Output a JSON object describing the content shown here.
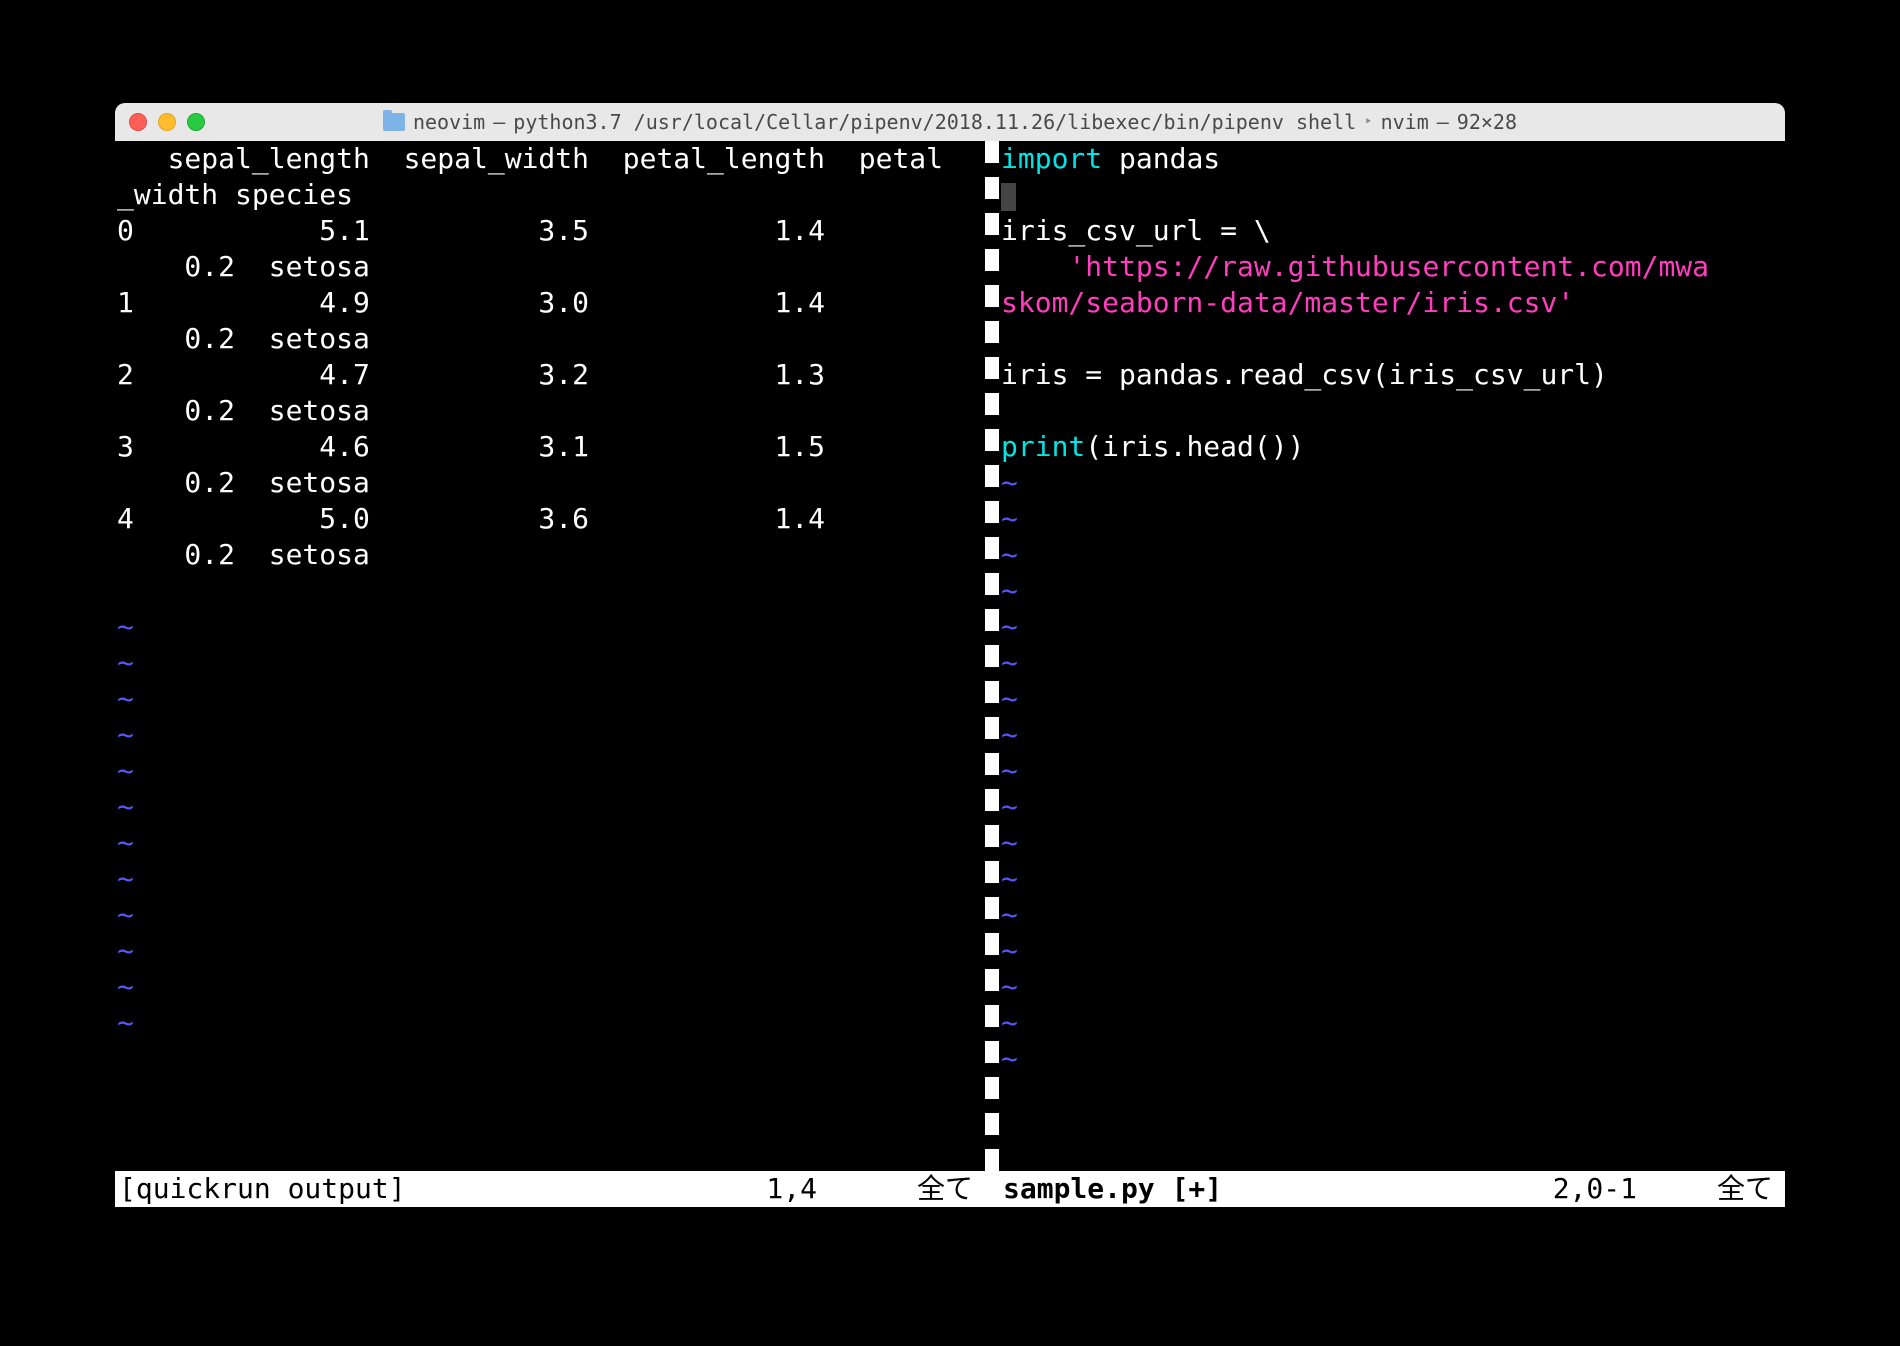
{
  "titlebar": {
    "folder_name": "neovim",
    "separator": "—",
    "process": "python3.7 /usr/local/Cellar/pipenv/2018.11.26/libexec/bin/pipenv shell",
    "arrow": "‣",
    "app": "nvim",
    "dims": "—",
    "size": "92×28"
  },
  "left": {
    "lines": [
      "   sepal_length  sepal_width  petal_length  petal",
      "_width species",
      "0           5.1          3.5           1.4       ",
      "    0.2  setosa",
      "1           4.9          3.0           1.4       ",
      "    0.2  setosa",
      "2           4.7          3.2           1.3       ",
      "    0.2  setosa",
      "3           4.6          3.1           1.5       ",
      "    0.2  setosa",
      "4           5.0          3.6           1.4       ",
      "    0.2  setosa",
      ""
    ],
    "tilde_count": 12,
    "status_name": "[quickrun output]",
    "status_pos": "1,4",
    "status_pct": "全て"
  },
  "right": {
    "code": {
      "l1_kw": "import",
      "l1_rest": " pandas",
      "l3": "iris_csv_url = \\",
      "l4_indent": "    ",
      "l4_str": "'https://raw.githubusercontent.com/mwa",
      "l5_str": "skom/seaborn-data/master/iris.csv'",
      "l7": "iris = pandas.read_csv(iris_csv_url)",
      "l9_kw": "print",
      "l9_rest": "(iris.head())"
    },
    "tilde_count": 17,
    "status_name": "sample.py [+]",
    "status_pos": "2,0-1",
    "status_pct": "全て"
  }
}
